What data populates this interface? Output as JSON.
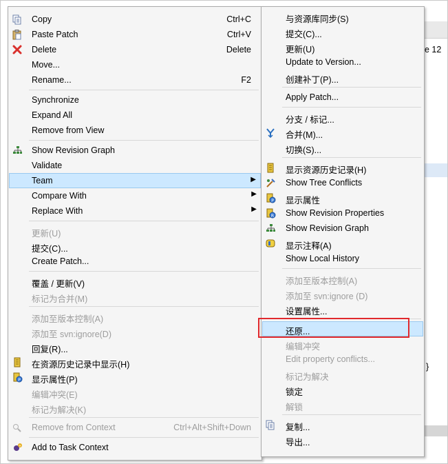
{
  "background": {
    "right_text": "e 12",
    "brace": "}"
  },
  "menu1": {
    "items": [
      {
        "label": "Copy",
        "shortcut": "Ctrl+C",
        "icon": "copy-icon"
      },
      {
        "label": "Paste Patch",
        "shortcut": "Ctrl+V",
        "icon": "paste-icon"
      },
      {
        "label": "Delete",
        "shortcut": "Delete",
        "icon": "delete-icon"
      },
      {
        "label": "Move...",
        "shortcut": ""
      },
      {
        "label": "Rename...",
        "shortcut": "F2"
      },
      {
        "label": "Synchronize"
      },
      {
        "label": "Expand All"
      },
      {
        "label": "Remove from View"
      },
      {
        "label": "Show Revision Graph",
        "icon": "revision-graph-icon"
      },
      {
        "label": "Validate"
      },
      {
        "label": "Team"
      },
      {
        "label": "Compare With"
      },
      {
        "label": "Replace With"
      },
      {
        "label": "更新(U)"
      },
      {
        "label": "提交(C)..."
      },
      {
        "label": "Create Patch..."
      },
      {
        "label": "覆盖 / 更新(V)"
      },
      {
        "label": "标记为合并(M)"
      },
      {
        "label": "添加至版本控制(A)"
      },
      {
        "label": "添加至 svn:ignore(D)"
      },
      {
        "label": "回复(R)..."
      },
      {
        "label": "在资源历史记录中显示(H)",
        "icon": "history-icon"
      },
      {
        "label": "显示属性(P)",
        "icon": "properties-icon"
      },
      {
        "label": "编辑冲突(E)"
      },
      {
        "label": "标记为解决(K)"
      },
      {
        "label": "Remove from Context",
        "shortcut": "Ctrl+Alt+Shift+Down",
        "icon": "remove-context-icon"
      },
      {
        "label": "Add to Task Context",
        "icon": "add-context-icon"
      }
    ]
  },
  "menu2": {
    "items": [
      {
        "label": "与资源库同步(S)"
      },
      {
        "label": "提交(C)..."
      },
      {
        "label": "更新(U)"
      },
      {
        "label": "Update to Version..."
      },
      {
        "label": "创建补丁(P)..."
      },
      {
        "label": "Apply Patch..."
      },
      {
        "label": "分支 / 标记..."
      },
      {
        "label": "合并(M)...",
        "icon": "merge-icon"
      },
      {
        "label": "切换(S)..."
      },
      {
        "label": "显示资源历史记录(H)",
        "icon": "history-icon"
      },
      {
        "label": "Show Tree Conflicts",
        "icon": "tree-conflicts-icon"
      },
      {
        "label": "显示属性",
        "icon": "properties-icon"
      },
      {
        "label": "Show Revision Properties",
        "icon": "revision-properties-icon"
      },
      {
        "label": "Show Revision Graph",
        "icon": "revision-graph-icon"
      },
      {
        "label": "显示注释(A)",
        "icon": "annotate-icon"
      },
      {
        "label": "Show Local History"
      },
      {
        "label": "添加至版本控制(A)"
      },
      {
        "label": "添加至 svn:ignore (D)"
      },
      {
        "label": "设置属性..."
      },
      {
        "label": "还原..."
      },
      {
        "label": "编辑冲突"
      },
      {
        "label": "Edit property conflicts..."
      },
      {
        "label": "标记为解决"
      },
      {
        "label": "锁定"
      },
      {
        "label": "解锁"
      },
      {
        "label": "复制...",
        "icon": "copy-icon"
      },
      {
        "label": "导出..."
      }
    ]
  },
  "colors": {
    "highlight_bg": "#cce8ff",
    "highlight_border": "#99c9ef",
    "annotation_box": "#e0282c",
    "disabled_text": "#9d9d9d"
  }
}
